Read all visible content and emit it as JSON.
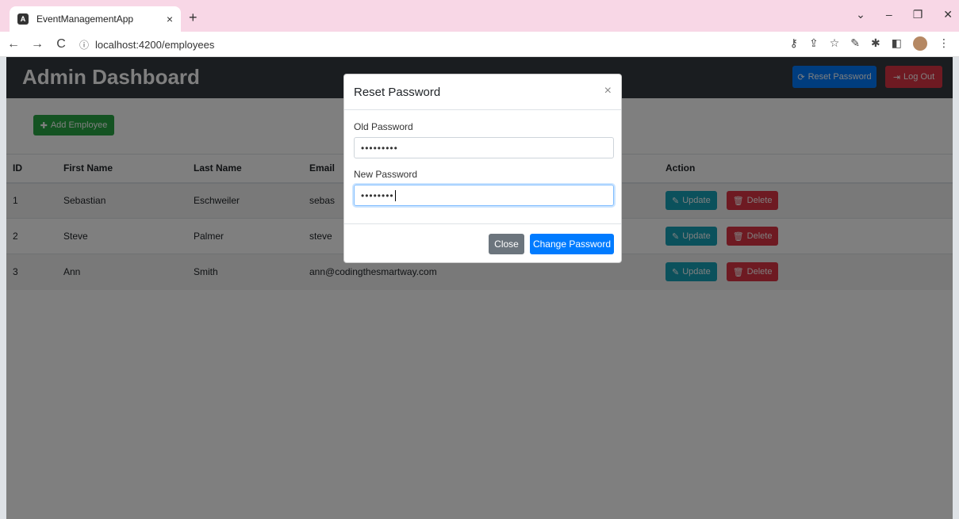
{
  "browser": {
    "tab_title": "EventManagementApp",
    "tab_close": "×",
    "new_tab": "+",
    "url": "localhost:4200/employees",
    "info_icon": "ⓘ"
  },
  "app": {
    "brand": "Admin Dashboard",
    "reset_password_label": "Reset Password",
    "logout_label": "Log Out",
    "add_employee_label": "Add Employee"
  },
  "table": {
    "headers": [
      "ID",
      "First Name",
      "Last Name",
      "Email",
      "Action"
    ],
    "rows": [
      {
        "id": "1",
        "first": "Sebastian",
        "last": "Eschweiler",
        "email": "sebas"
      },
      {
        "id": "2",
        "first": "Steve",
        "last": "Palmer",
        "email": "steve"
      },
      {
        "id": "3",
        "first": "Ann",
        "last": "Smith",
        "email": "ann@codingthesmartway.com"
      }
    ],
    "update_label": "Update",
    "delete_label": "Delete"
  },
  "modal": {
    "title": "Reset Password",
    "close_x": "×",
    "old_password_label": "Old Password",
    "old_password_value": "•••••••••",
    "new_password_label": "New Password",
    "new_password_value": "••••••••",
    "close_label": "Close",
    "change_label": "Change Password"
  },
  "colors": {
    "navbar": "#343a40",
    "primary": "#007bff",
    "danger": "#dc3545",
    "success": "#28a745",
    "info": "#17a2b8",
    "secondary": "#6c757d"
  }
}
